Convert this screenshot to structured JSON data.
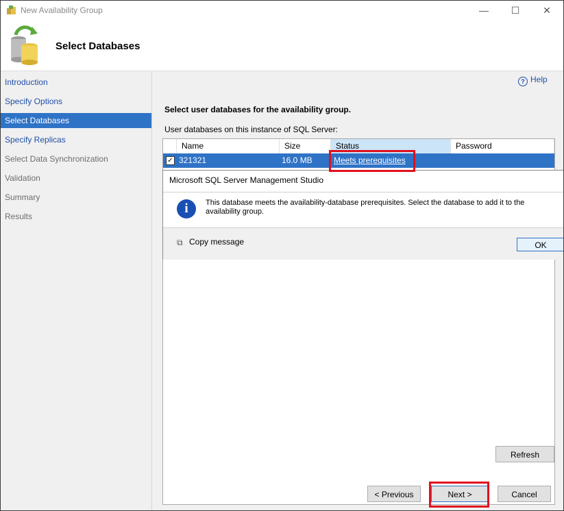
{
  "window": {
    "title": "New Availability Group"
  },
  "header": {
    "title": "Select Databases"
  },
  "help": {
    "label": "Help"
  },
  "nav": {
    "items": [
      {
        "label": "Introduction",
        "state": "link"
      },
      {
        "label": "Specify Options",
        "state": "link"
      },
      {
        "label": "Select Databases",
        "state": "active"
      },
      {
        "label": "Specify Replicas",
        "state": "link"
      },
      {
        "label": "Select Data Synchronization",
        "state": "dim"
      },
      {
        "label": "Validation",
        "state": "dim"
      },
      {
        "label": "Summary",
        "state": "dim"
      },
      {
        "label": "Results",
        "state": "dim"
      }
    ]
  },
  "main": {
    "instruction": "Select user databases for the availability group.",
    "subheading": "User databases on this instance of SQL Server:",
    "columns": [
      "Name",
      "Size",
      "Status",
      "Password"
    ],
    "rows": [
      {
        "checked": true,
        "name": "321321",
        "size": "16.0 MB",
        "status": "Meets prerequisites",
        "password": ""
      }
    ],
    "refresh": "Refresh"
  },
  "dialog": {
    "title": "Microsoft SQL Server Management Studio",
    "message": "This database meets the availability-database prerequisites. Select the database to add it to the availability group.",
    "copy_label": "Copy message",
    "ok_label": "OK"
  },
  "footer": {
    "previous": "< Previous",
    "next": "Next >",
    "cancel": "Cancel"
  },
  "colors": {
    "selection": "#2f73c6",
    "highlight": "#e0101d",
    "link": "#1f4fa8"
  }
}
